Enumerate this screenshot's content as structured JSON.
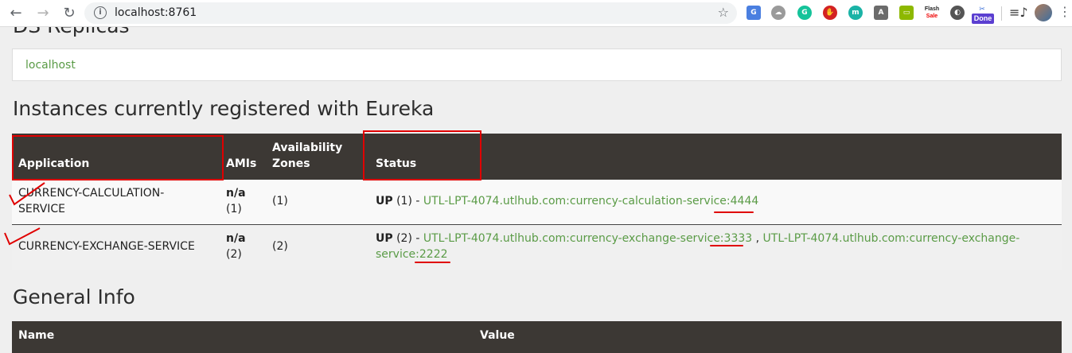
{
  "browser": {
    "url": "localhost:8761",
    "done_badge": "Done",
    "flash_top": "Flash",
    "flash_bottom": "Sale"
  },
  "page": {
    "replicas_heading": "DS Replicas",
    "replica_host": "localhost",
    "instances_title": "Instances currently registered with Eureka",
    "table_headers": {
      "application": "Application",
      "amis": "AMIs",
      "availability_zones_line1": "Availability",
      "availability_zones_line2": "Zones",
      "status": "Status"
    },
    "rows": [
      {
        "application_line1": "CURRENCY-CALCULATION-",
        "application_line2": "SERVICE",
        "amis_line1": "n/a",
        "amis_line2": "(1)",
        "zones": "(1)",
        "status_prefix": "UP",
        "status_count": " (1) - ",
        "link_host": "UTL-LPT-4074.utlhub.com:currency-calculation-service:",
        "link_port": "4444"
      },
      {
        "application": "CURRENCY-EXCHANGE-SERVICE",
        "amis_line1": "n/a",
        "amis_line2": "(2)",
        "zones": "(2)",
        "status_prefix": "UP",
        "status_count": " (2) - ",
        "link1_host": "UTL-LPT-4074.utlhub.com:currency-exchange-service:",
        "link1_port": "3333",
        "separator": " , ",
        "link2_host_line1": "UTL-LPT-4074.utlhub.com:currency-exchange-",
        "link2_host_line2": "service:",
        "link2_port": "2222"
      }
    ],
    "general_info_title": "General Info",
    "general_headers": {
      "name": "Name",
      "value": "Value"
    }
  },
  "colors": {
    "header_bg": "#3c3834",
    "link_green": "#5a9b46",
    "annotation_red": "#e00000"
  }
}
